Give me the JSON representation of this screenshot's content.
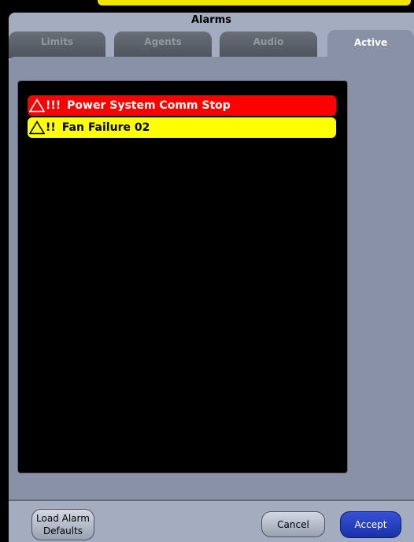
{
  "dialog": {
    "title": "Alarms"
  },
  "tabs": [
    {
      "label": "Limits",
      "active": false
    },
    {
      "label": "Agents",
      "active": false
    },
    {
      "label": "Audio",
      "active": false
    },
    {
      "label": "Active",
      "active": true
    }
  ],
  "alarms": [
    {
      "priority": "!!!",
      "text": "Power System Comm Stop",
      "color": "#ff0000",
      "text_color": "#ffffff",
      "icon": "warning-triangle-icon"
    },
    {
      "priority": "!!",
      "text": "Fan Failure 02",
      "color": "#ffff00",
      "text_color": "#000000",
      "icon": "warning-triangle-icon"
    }
  ],
  "footer": {
    "load_defaults_label": "Load Alarm Defaults",
    "cancel_label": "Cancel",
    "accept_label": "Accept"
  },
  "colors": {
    "dialog_bg": "#a3adbf",
    "panel_bg": "#8891a6",
    "accept_bg": "#2a40c4",
    "banner": "#f2e400"
  }
}
